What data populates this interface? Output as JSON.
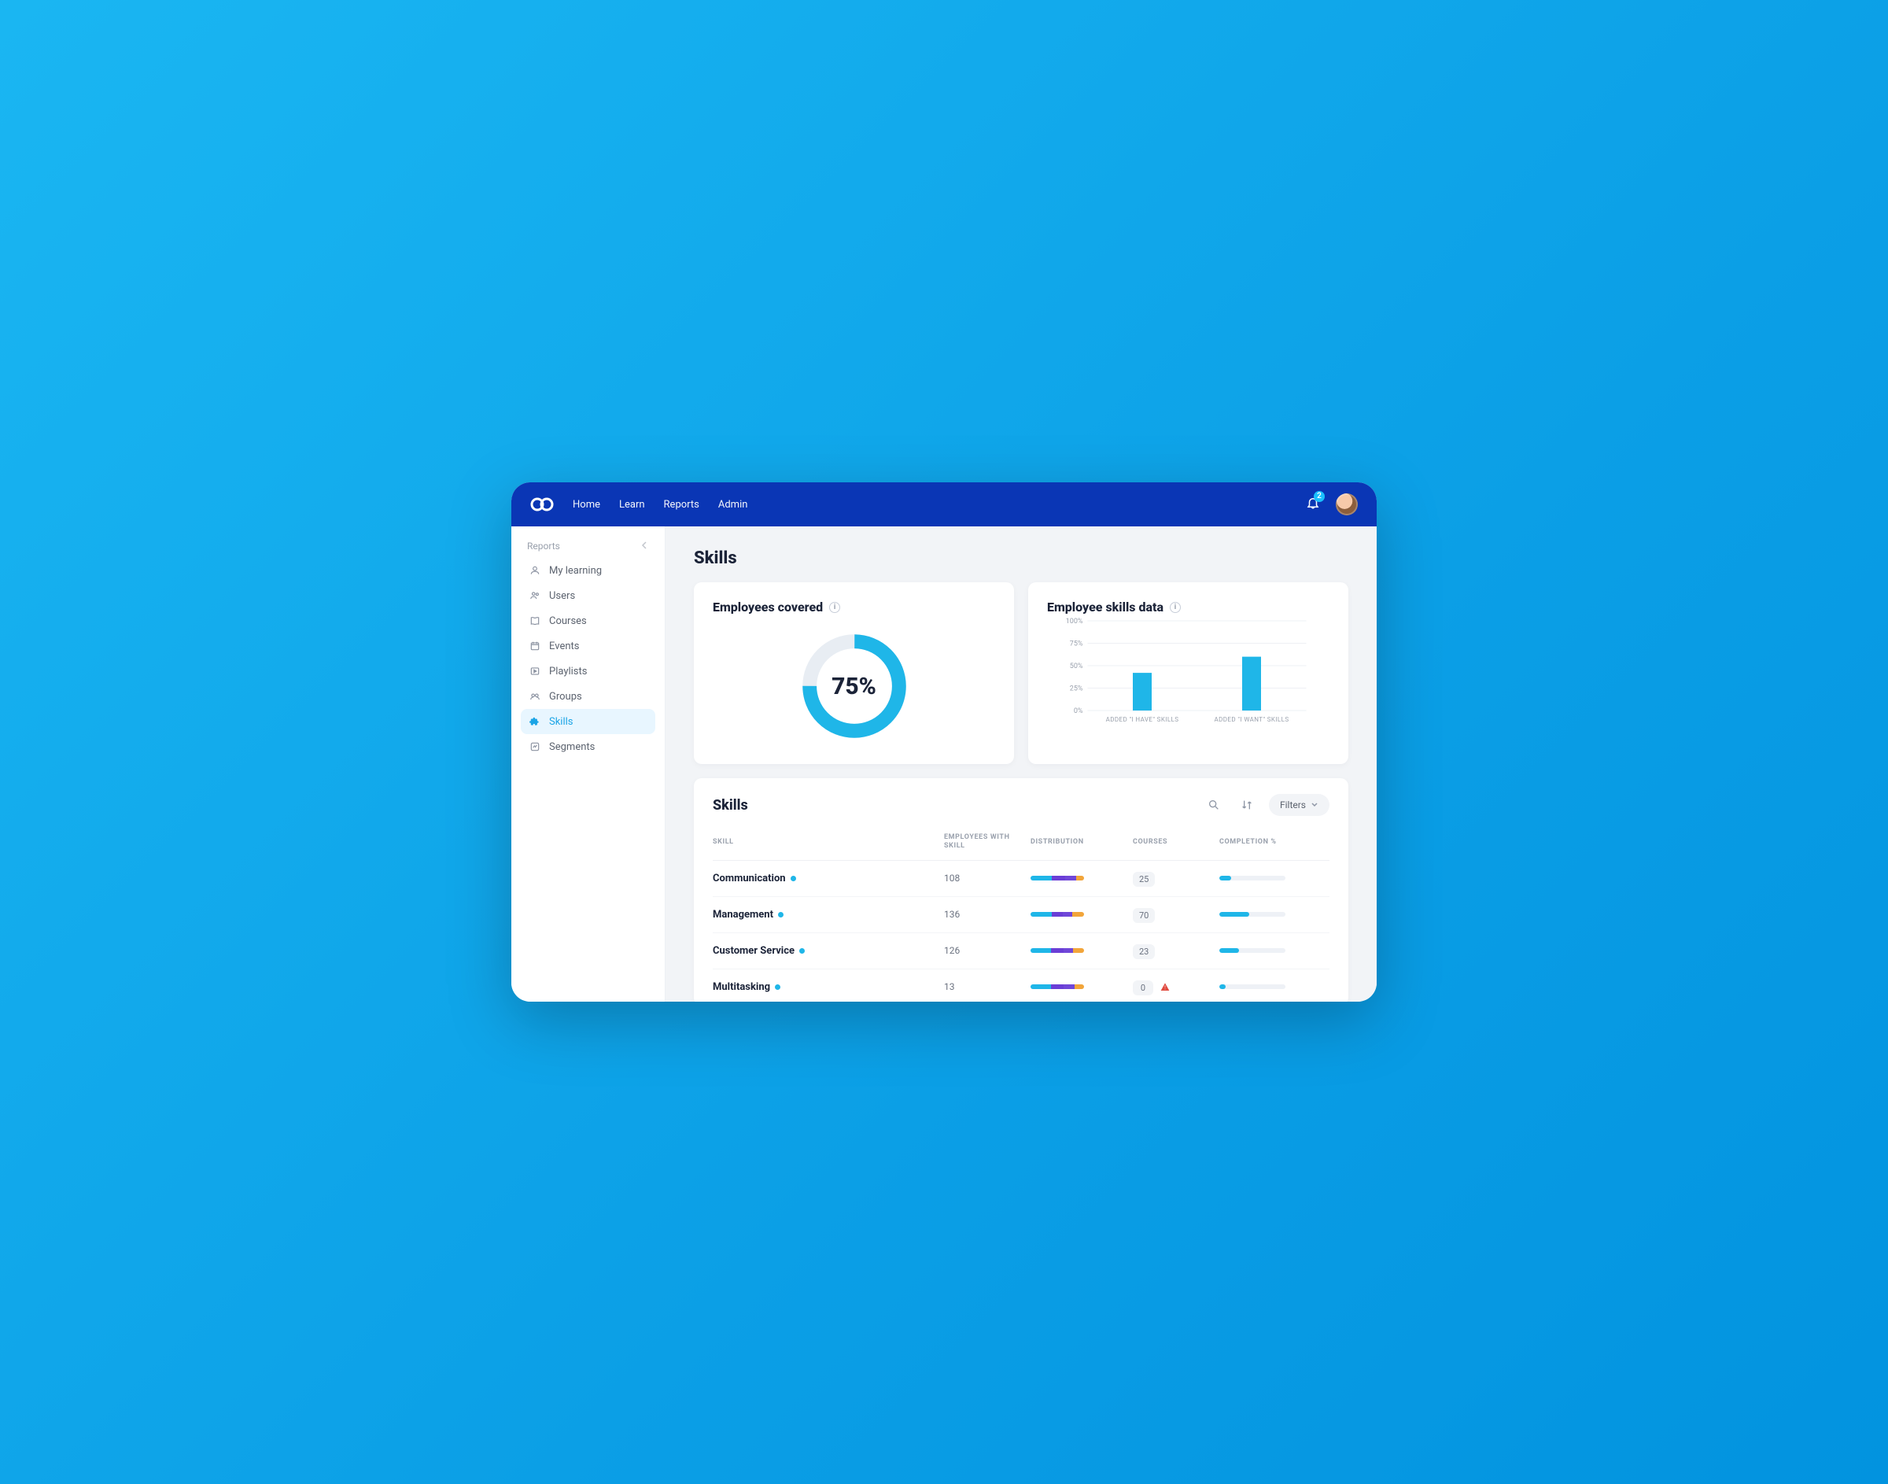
{
  "colors": {
    "primary": "#0a36b5",
    "accent": "#1fb6e8",
    "purple": "#6a3ed6",
    "orange": "#f2a53a",
    "warn": "#e04a3f"
  },
  "topnav": {
    "items": [
      "Home",
      "Learn",
      "Reports",
      "Admin"
    ],
    "notification_count": "2"
  },
  "sidebar": {
    "title": "Reports",
    "items": [
      {
        "icon": "person-learning",
        "label": "My learning",
        "active": false
      },
      {
        "icon": "users",
        "label": "Users",
        "active": false
      },
      {
        "icon": "book",
        "label": "Courses",
        "active": false
      },
      {
        "icon": "calendar",
        "label": "Events",
        "active": false
      },
      {
        "icon": "playlist",
        "label": "Playlists",
        "active": false
      },
      {
        "icon": "groups",
        "label": "Groups",
        "active": false
      },
      {
        "icon": "puzzle",
        "label": "Skills",
        "active": true
      },
      {
        "icon": "segments",
        "label": "Segments",
        "active": false
      }
    ]
  },
  "page": {
    "title": "Skills",
    "coverage_card": {
      "title": "Employees covered",
      "percent_label": "75%",
      "percent_value": 75
    },
    "skills_chart": {
      "title": "Employee skills data"
    },
    "table_card": {
      "title": "Skills",
      "filters_label": "Filters",
      "columns": {
        "skill": "SKILL",
        "employees": "EMPLOYEES WITH SKILL",
        "distribution": "DISTRIBUTION",
        "courses": "COURSES",
        "completion": "COMPLETION %"
      },
      "rows": [
        {
          "skill": "Communication",
          "employees": "108",
          "courses": "25",
          "warn": false,
          "completion_pct": 18,
          "dist": [
            40,
            25,
            20,
            15
          ]
        },
        {
          "skill": "Management",
          "employees": "136",
          "courses": "70",
          "warn": false,
          "completion_pct": 45,
          "dist": [
            40,
            20,
            18,
            22
          ]
        },
        {
          "skill": "Customer Service",
          "employees": "126",
          "courses": "23",
          "warn": false,
          "completion_pct": 30,
          "dist": [
            38,
            24,
            18,
            20
          ]
        },
        {
          "skill": "Multitasking",
          "employees": "13",
          "courses": "0",
          "warn": true,
          "completion_pct": 10,
          "dist": [
            38,
            24,
            20,
            18
          ]
        }
      ]
    }
  },
  "chart_data": {
    "type": "bar",
    "title": "Employee skills data",
    "categories": [
      "ADDED \"I HAVE\" SKILLS",
      "ADDED \"I WANT\" SKILLS"
    ],
    "values": [
      42,
      60
    ],
    "ylabel": "%",
    "ylim": [
      0,
      100
    ],
    "yticks": [
      "0%",
      "25%",
      "50%",
      "75%",
      "100%"
    ]
  }
}
